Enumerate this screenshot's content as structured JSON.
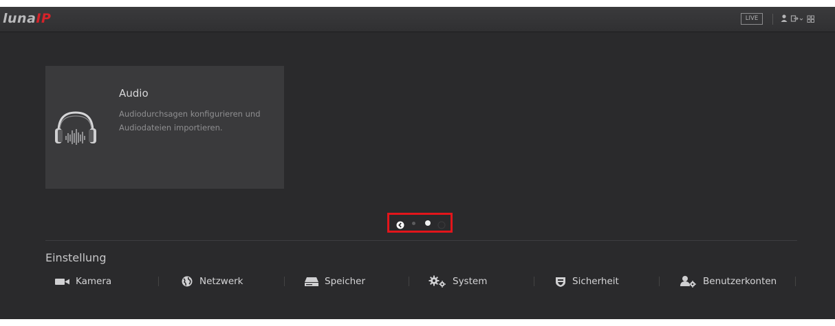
{
  "header": {
    "logo_luna": "luna",
    "logo_ip": "IP",
    "live_label": "LIVE",
    "icons": [
      "user-icon",
      "logout-icon",
      "grid-icon"
    ]
  },
  "card": {
    "title": "Audio",
    "description": "Audiodurchsagen konfigurieren und Audiodateien importieren.",
    "icon": "headphones-icon"
  },
  "pagination": {
    "pages": 3,
    "current_page": 2
  },
  "settings": {
    "title": "Einstellung",
    "items": [
      {
        "label": "Kamera",
        "icon": "camera-icon"
      },
      {
        "label": "Netzwerk",
        "icon": "globe-icon"
      },
      {
        "label": "Speicher",
        "icon": "storage-icon"
      },
      {
        "label": "System",
        "icon": "gears-icon"
      },
      {
        "label": "Sicherheit",
        "icon": "shield-icon"
      },
      {
        "label": "Benutzerkonten",
        "icon": "users-icon"
      }
    ]
  },
  "colors": {
    "background": "#2a2a2c",
    "card": "#3a3a3c",
    "brand_red": "#d4232a",
    "highlight_box": "#e3151b"
  }
}
